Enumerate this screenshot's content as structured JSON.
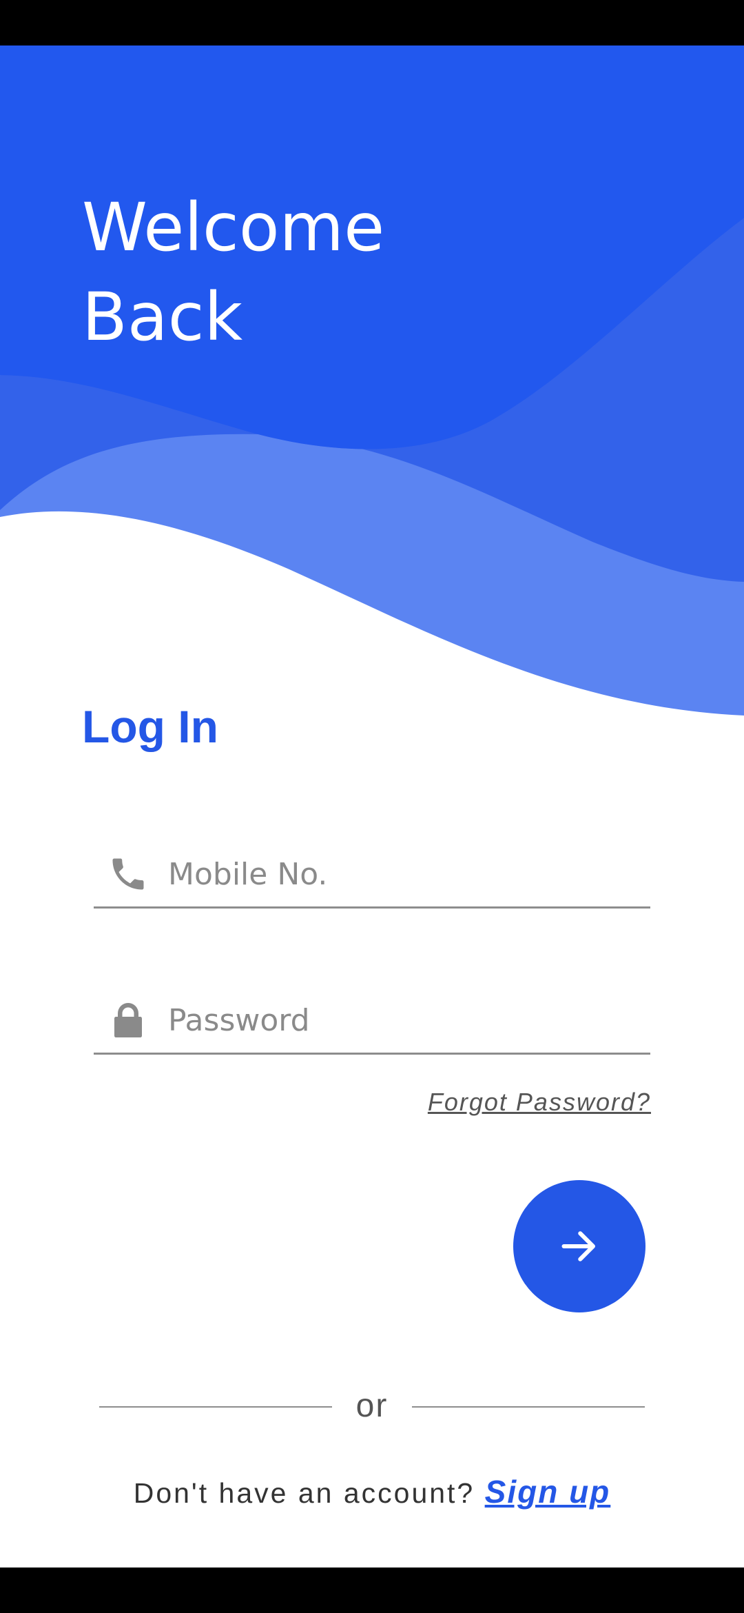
{
  "header": {
    "welcome_line1": "Welcome",
    "welcome_line2": "Back"
  },
  "login": {
    "title": "Log In",
    "mobile": {
      "placeholder": "Mobile No.",
      "value": "",
      "icon": "phone-icon"
    },
    "password": {
      "placeholder": "Password",
      "value": "",
      "icon": "lock-icon"
    },
    "forgot_label": "Forgot Password?",
    "submit_icon": "arrow-right-icon"
  },
  "divider": {
    "or_label": "or"
  },
  "signup": {
    "prompt": "Don't have an account?",
    "link_label": "Sign up"
  },
  "colors": {
    "primary": "#2457e6",
    "wave_light": "#5b84f2",
    "wave_mid": "#3362ea",
    "text_muted": "#8a8a8a"
  }
}
